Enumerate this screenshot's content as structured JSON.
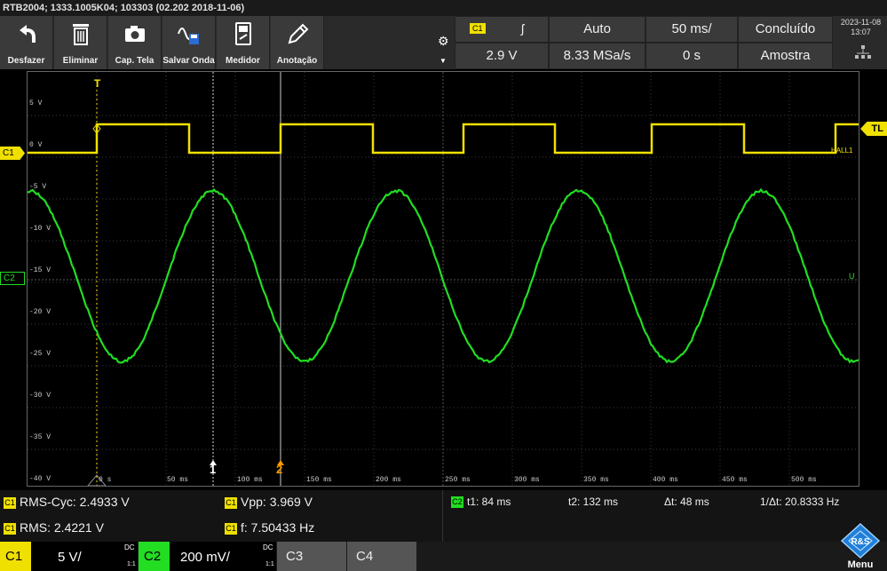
{
  "title_bar": "RTB2004; 1333.1005K04; 103303 (02.202 2018-11-06)",
  "toolbar": {
    "buttons": [
      {
        "label": "Desfazer",
        "icon": "undo-icon"
      },
      {
        "label": "Eliminar",
        "icon": "trash-icon"
      },
      {
        "label": "Cap. Tela",
        "icon": "camera-icon"
      },
      {
        "label": "Salvar Onda",
        "icon": "save-wave-icon"
      },
      {
        "label": "Medidor",
        "icon": "meter-icon"
      },
      {
        "label": "Anotação",
        "icon": "pen-icon"
      }
    ],
    "trigger_source": "C1",
    "trigger_level": "2.9 V",
    "mode": "Auto",
    "sample_rate": "8.33 MSa/s",
    "time_scale": "50 ms/",
    "time_offset": "0 s",
    "status": "Concluído",
    "acq_mode": "Amostra",
    "date": "2023-11-08",
    "time": "13:07"
  },
  "plot": {
    "y_labels": [
      "5 V",
      "0 V",
      "-5 V",
      "-10 V",
      "-15 V",
      "-20 V",
      "-25 V",
      "-30 V",
      "-35 V",
      "-40 V"
    ],
    "x_labels": [
      "0 s",
      "50 ms",
      "100 ms",
      "150 ms",
      "200 ms",
      "250 ms",
      "300 ms",
      "350 ms",
      "400 ms",
      "450 ms",
      "500 ms"
    ],
    "c1_marker": "C1",
    "c2_marker": "C2",
    "trigger_label": "TL",
    "trigger_top": "T",
    "hall_label": "HALL1",
    "u_label": "U",
    "cursor1": "1",
    "cursor2": "2",
    "colors": {
      "c1": "#f0e000",
      "c2": "#22dd22",
      "cursor2": "#ff9a00"
    }
  },
  "measurements": {
    "rms_cyc": "RMS-Cyc: 2.4933 V",
    "rms": "RMS: 2.4221 V",
    "vpp": "Vpp: 3.969 V",
    "freq": "f: 7.50433 Hz",
    "c1_tag": "C1",
    "c2_tag": "C2",
    "t1": "t1: 84 ms",
    "t2": "t2: 132 ms",
    "dt": "Δt: 48 ms",
    "inv_dt": "1/Δt: 20.8333 Hz"
  },
  "channels": {
    "c1_name": "C1",
    "c1_scale": "5 V/",
    "c1_coupling": "DC",
    "c1_probe": "1:1",
    "c2_name": "C2",
    "c2_scale": "200 mV/",
    "c2_coupling": "DC",
    "c2_probe": "1:1",
    "c3_name": "C3",
    "c4_name": "C4",
    "menu_label": "Menu"
  }
}
